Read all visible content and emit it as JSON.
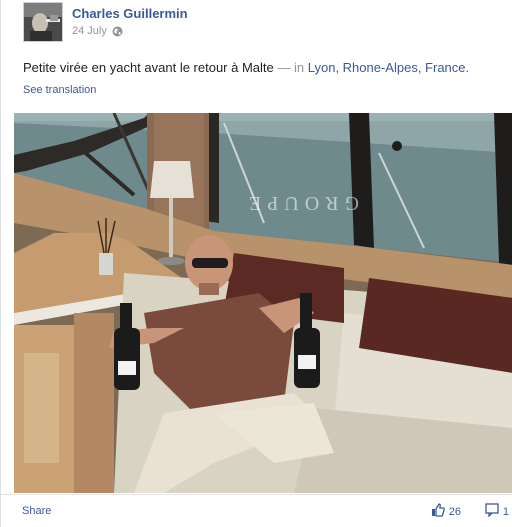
{
  "post": {
    "author": "Charles Guillermin",
    "date": "24 July",
    "text_main": "Petite virée en yacht avant le retour à Malte",
    "text_separator": "— in",
    "location": "Lyon, Rhone-Alpes, France.",
    "see_translation": "See translation",
    "photo_sign_text": "GROUPE"
  },
  "footer": {
    "share_label": "Share",
    "likes_count": "26",
    "comments_count": "1"
  },
  "icons": {
    "audience": "globe-icon",
    "like": "thumbs-up-icon",
    "comment": "comment-icon"
  },
  "colors": {
    "link": "#3b5998",
    "muted": "#90949c",
    "text": "#1d2129"
  }
}
